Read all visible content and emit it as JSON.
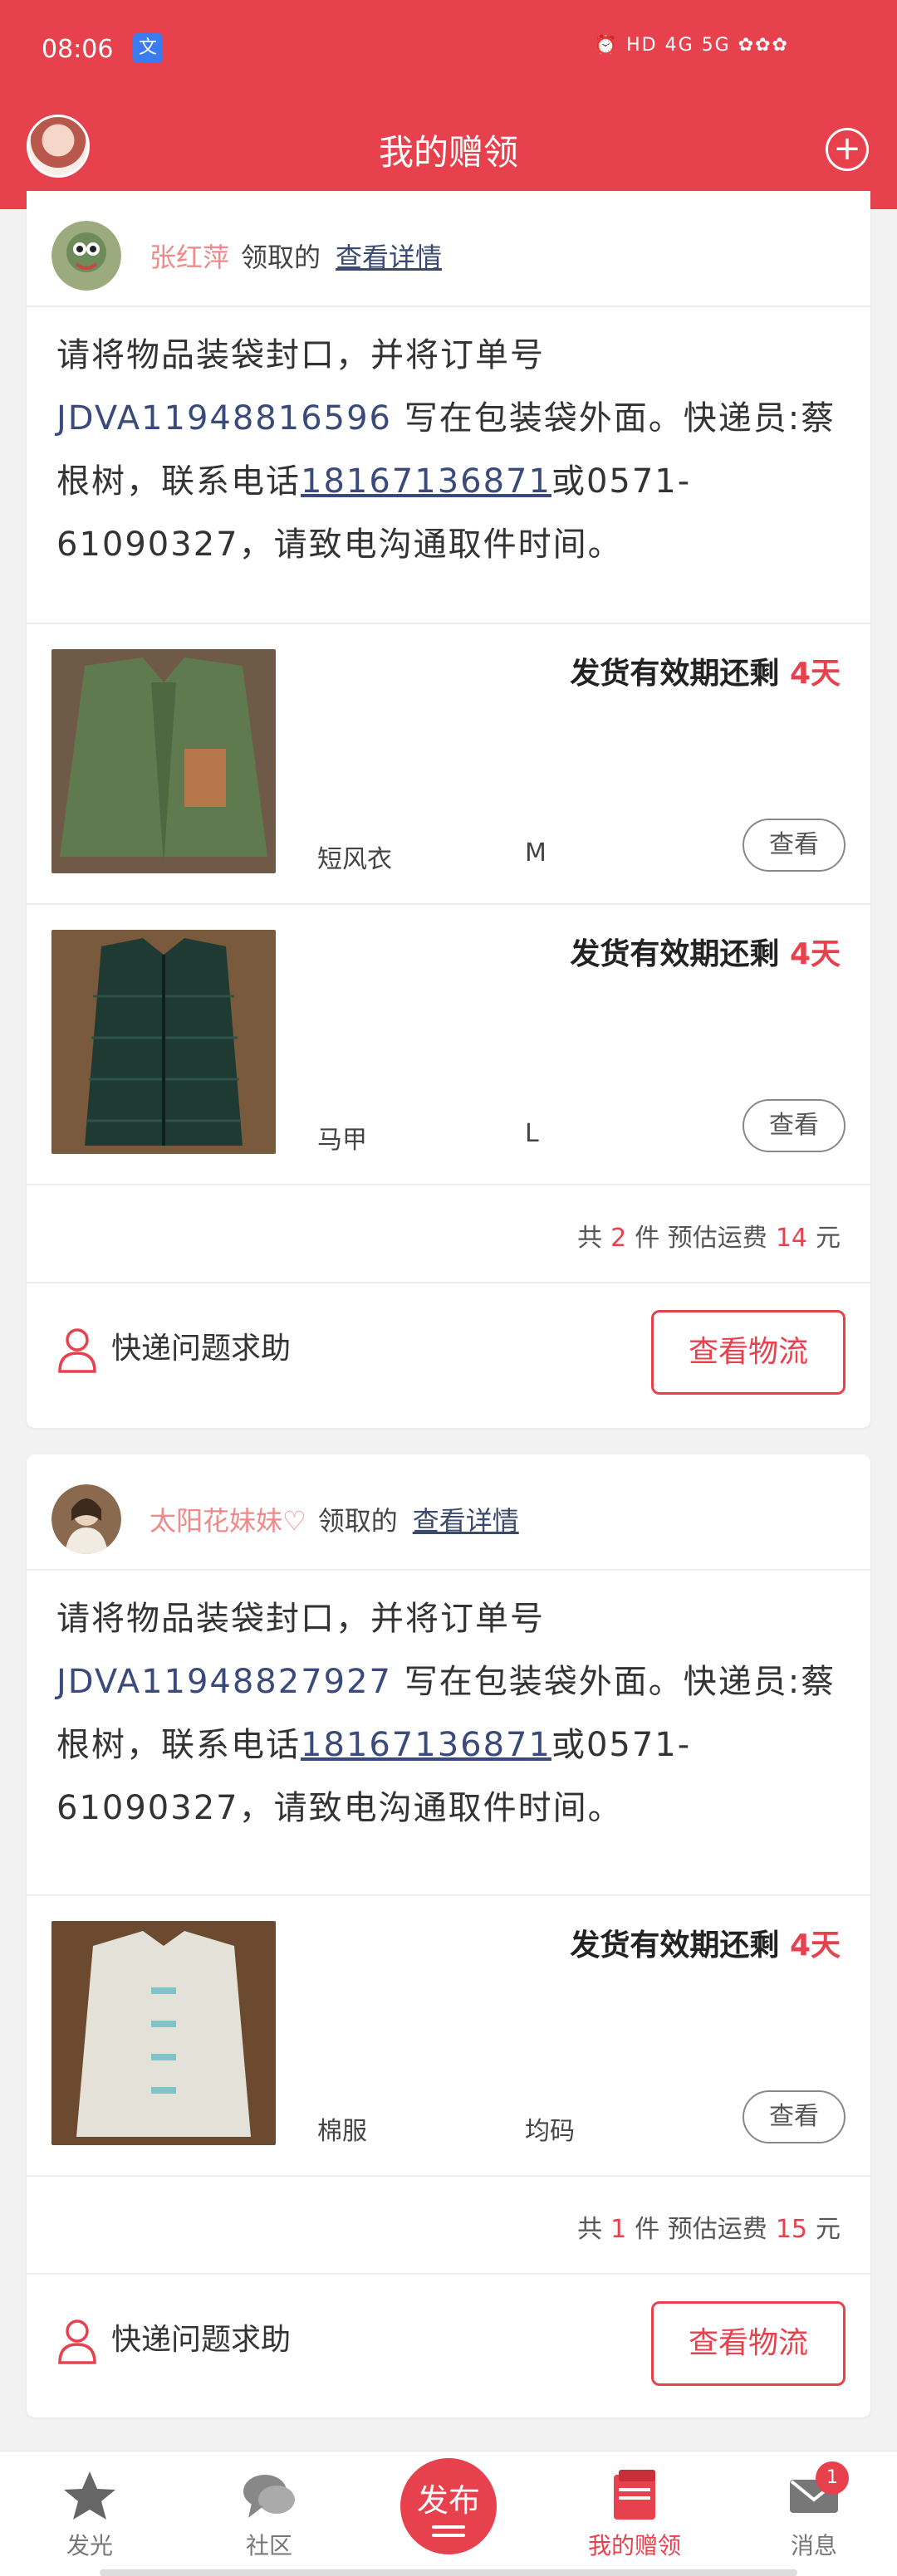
{
  "status": {
    "time": "08:06",
    "app_badge": "文",
    "right": "⏰ HD 4G 5G ✿✿✿"
  },
  "header": {
    "title": "我的赠领",
    "plus": "+"
  },
  "orders": [
    {
      "receiver": "张红萍",
      "verb": "领取的",
      "detail_link": "查看详情",
      "notice_pre": "请将物品装袋封口，并将订单号 ",
      "order_no": "JDVA11948816596",
      "notice_mid": " 写在包装袋外面。快递员:蔡根树，联系电话",
      "phone": "18167136871",
      "notice_post": "或0571-61090327，请致电沟通取件时间。",
      "items": [
        {
          "deadline_prefix": "发货有效期还剩",
          "deadline_days": "4天",
          "name": "短风衣",
          "size": "M",
          "view": "查看"
        },
        {
          "deadline_prefix": "发货有效期还剩",
          "deadline_days": "4天",
          "name": "马甲",
          "size": "L",
          "view": "查看"
        }
      ],
      "summary": {
        "pre": "共",
        "count": "2",
        "mid": "件 预估运费",
        "fee": "14",
        "unit": "元"
      },
      "help": "快递问题求助",
      "logistics": "查看物流"
    },
    {
      "receiver": "太阳花妹妹♡",
      "verb": "领取的",
      "detail_link": "查看详情",
      "notice_pre": "请将物品装袋封口，并将订单号 ",
      "order_no": "JDVA11948827927",
      "notice_mid": " 写在包装袋外面。快递员:蔡根树，联系电话",
      "phone": "18167136871",
      "notice_post": "或0571-61090327，请致电沟通取件时间。",
      "items": [
        {
          "deadline_prefix": "发货有效期还剩",
          "deadline_days": "4天",
          "name": "棉服",
          "size": "均码",
          "view": "查看"
        }
      ],
      "summary": {
        "pre": "共",
        "count": "1",
        "mid": "件 预估运费",
        "fee": "15",
        "unit": "元"
      },
      "help": "快递问题求助",
      "logistics": "查看物流"
    }
  ],
  "tabbar": {
    "items": [
      {
        "label": "发光",
        "icon": "star-icon"
      },
      {
        "label": "社区",
        "icon": "chat-icon"
      },
      {
        "label": "发布",
        "icon": "publish-icon"
      },
      {
        "label": "我的赠领",
        "icon": "gift-box-icon"
      },
      {
        "label": "消息",
        "icon": "mail-icon",
        "badge": "1"
      }
    ]
  },
  "colors": {
    "accent": "#e8414e",
    "link": "#3a4a6e"
  }
}
